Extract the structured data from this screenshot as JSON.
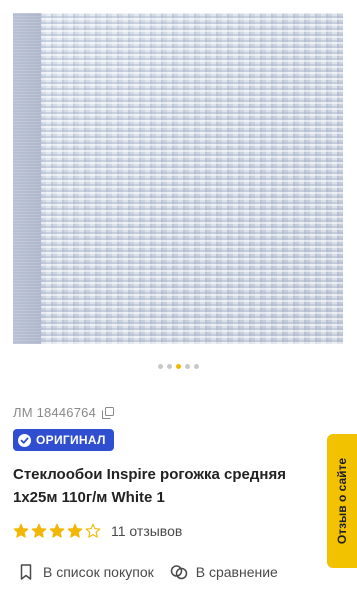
{
  "carousel": {
    "total": 5,
    "active_index": 2
  },
  "product": {
    "sku_label": "ЛМ 18446764",
    "badge_label": "ОРИГИНАЛ",
    "title": "Стеклообои Inspire рогожка средняя 1х25м 110г/м White 1",
    "rating": 4,
    "rating_max": 5,
    "reviews_label": "11 отзывов"
  },
  "actions": {
    "shopping_list_label": "В список покупок",
    "compare_label": "В сравнение"
  },
  "feedback": {
    "label": "Отзыв о сайте"
  },
  "colors": {
    "badge_bg": "#2f4fd0",
    "star": "#f2b705",
    "feedback_bg": "#f2c200",
    "dot_active": "#f2b705",
    "dot_inactive": "#c8c8c8"
  },
  "icons": {
    "copy": "copy-icon",
    "badge": "check-shield-icon",
    "shopping_list": "bookmark-icon",
    "compare": "compare-icon"
  }
}
